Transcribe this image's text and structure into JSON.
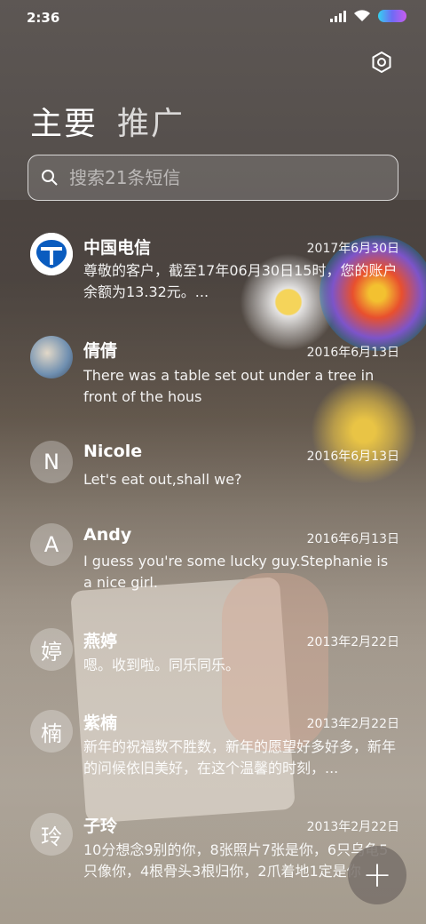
{
  "status_bar": {
    "time": "2:36"
  },
  "tabs": {
    "primary": "主要",
    "promo": "推广"
  },
  "search": {
    "placeholder": "搜索21条短信"
  },
  "threads": [
    {
      "name": "中国电信",
      "date": "2017年6月30日",
      "snippet": "尊敬的客户，截至17年06月30日15时，您的账户余额为13.32元。...",
      "avatar": "",
      "avatar_type": "telecom-logo-icon"
    },
    {
      "name": "倩倩",
      "date": "2016年6月13日",
      "snippet": "There was a table set out under a tree in front of the hous",
      "avatar": "",
      "avatar_type": "contact-photo"
    },
    {
      "name": "Nicole",
      "date": "2016年6月13日",
      "snippet": "Let's eat out,shall we?",
      "avatar": "N"
    },
    {
      "name": "Andy",
      "date": "2016年6月13日",
      "snippet": "I guess you're some lucky guy.Stephanie is a nice girl.",
      "avatar": "A"
    },
    {
      "name": "燕婷",
      "date": "2013年2月22日",
      "snippet": "嗯。收到啦。同乐同乐。",
      "avatar": "婷"
    },
    {
      "name": "紫楠",
      "date": "2013年2月22日",
      "snippet": "新年的祝福数不胜数，新年的愿望好多好多，新年的问候依旧美好，在这个温馨的时刻，...",
      "avatar": "楠"
    },
    {
      "name": "子玲",
      "date": "2013年2月22日",
      "snippet": "10分想念9别的你，8张照片7张是你，6只乌龟5只像你，4根骨头3根归你，2爪着地1定是你",
      "avatar": "玲"
    }
  ],
  "fab": {
    "label": "+"
  },
  "icons": {
    "settings": "gear-icon",
    "search": "search-icon",
    "compose": "plus-icon"
  }
}
